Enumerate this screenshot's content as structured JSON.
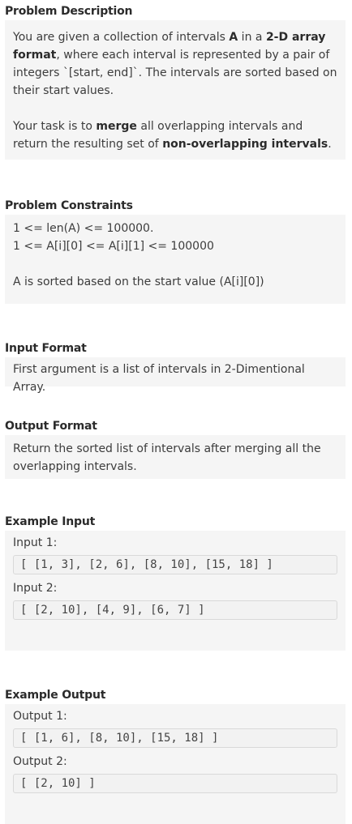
{
  "description": {
    "title": "Problem Description",
    "p1_a": "You are given a collection of intervals ",
    "p1_b": "A",
    "p1_c": " in a ",
    "p1_d": "2-D array format",
    "p1_e": ", where each interval is represented by a pair of integers `[start, end]`. The intervals are sorted based on their start values.",
    "p2_a": "Your task is to ",
    "p2_b": "merge",
    "p2_c": " all overlapping intervals and return the resulting set of ",
    "p2_d": "non-overlapping intervals",
    "p2_e": "."
  },
  "constraints": {
    "title": "Problem Constraints",
    "line1": "1 <= len(A) <= 100000.",
    "line2": "1 <= A[i][0] <= A[i][1] <= 100000",
    "line3": "A is sorted based on the start value (A[i][0])"
  },
  "input_format": {
    "title": "Input Format",
    "text": "First argument is a list of intervals in 2-Dimentional Array."
  },
  "output_format": {
    "title": "Output Format",
    "text": "Return the sorted list of intervals after merging all the overlapping intervals."
  },
  "example_input": {
    "title": "Example Input",
    "label1": "Input 1:",
    "code1": "[ [1, 3], [2, 6], [8, 10], [15, 18] ]",
    "label2": "Input 2:",
    "code2": "[ [2, 10], [4, 9], [6, 7] ]"
  },
  "example_output": {
    "title": "Example Output",
    "label1": "Output 1:",
    "code1": "[ [1, 6], [8, 10], [15, 18] ]",
    "label2": "Output 2:",
    "code2": "[ [2, 10] ]"
  }
}
